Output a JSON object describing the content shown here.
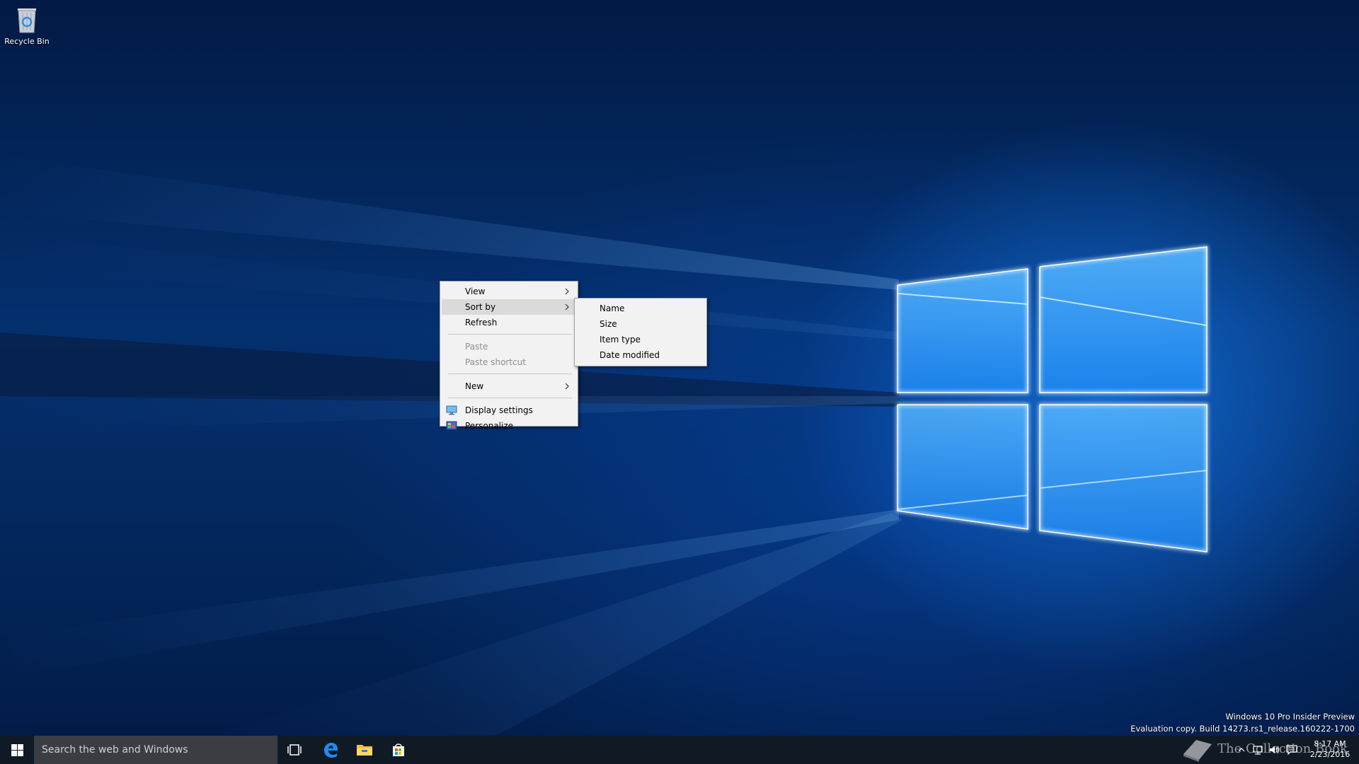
{
  "desktop": {
    "icons": [
      {
        "label": "Recycle Bin",
        "icon": "recycle-bin-icon"
      }
    ]
  },
  "context_menu": {
    "items": [
      {
        "label": "View",
        "submenu": true
      },
      {
        "label": "Sort by",
        "submenu": true,
        "highlighted": true
      },
      {
        "label": "Refresh"
      },
      {
        "label": "Paste",
        "disabled": true
      },
      {
        "label": "Paste shortcut",
        "disabled": true
      },
      {
        "label": "New",
        "submenu": true
      },
      {
        "label": "Display settings",
        "icon": "display-settings-icon"
      },
      {
        "label": "Personalize",
        "icon": "personalize-icon"
      }
    ]
  },
  "sort_submenu": {
    "items": [
      {
        "label": "Name"
      },
      {
        "label": "Size"
      },
      {
        "label": "Item type"
      },
      {
        "label": "Date modified"
      }
    ]
  },
  "taskbar": {
    "search_placeholder": "Search the web and Windows",
    "pinned": [
      "task-view-icon",
      "edge-icon",
      "file-explorer-icon",
      "store-icon"
    ],
    "clock": {
      "time": "8:17 AM",
      "date": "2/23/2016"
    }
  },
  "watermark": {
    "line1": "Windows 10 Pro Insider Preview",
    "line2": "Evaluation copy. Build 14273.rs1_release.160222-1700"
  },
  "overlay_brand": "The Collection Book",
  "colors": {
    "menu_bg": "#f2f2f2",
    "menu_highlight": "#dadada",
    "taskbar": "#101a24",
    "search_box": "#3a3e43",
    "accent": "#1e90ff"
  }
}
